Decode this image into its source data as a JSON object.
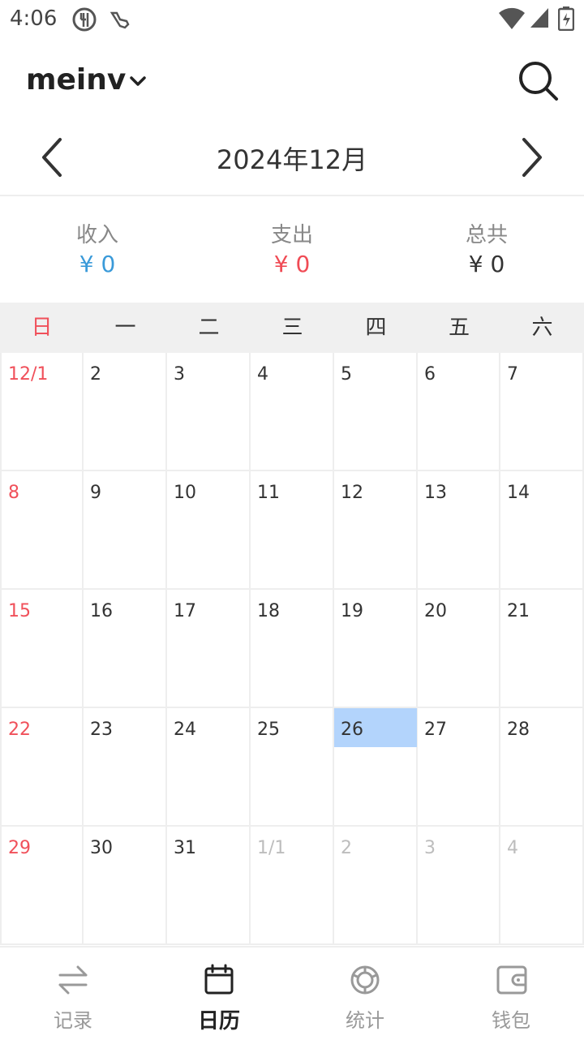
{
  "status_bar": {
    "time": "4:06"
  },
  "header": {
    "title": "meinv"
  },
  "month_nav": {
    "label": "2024年12月"
  },
  "summary": {
    "income": {
      "label": "收入",
      "value": "¥ 0",
      "color": "#3a9ad9"
    },
    "expense": {
      "label": "支出",
      "value": "¥ 0",
      "color": "#f04b55"
    },
    "total": {
      "label": "总共",
      "value": "¥ 0",
      "color": "#333333"
    }
  },
  "weekdays": [
    "日",
    "一",
    "二",
    "三",
    "四",
    "五",
    "六"
  ],
  "calendar": {
    "weeks": [
      [
        {
          "d": "12/1",
          "t": "sun"
        },
        {
          "d": "2"
        },
        {
          "d": "3"
        },
        {
          "d": "4"
        },
        {
          "d": "5"
        },
        {
          "d": "6"
        },
        {
          "d": "7"
        }
      ],
      [
        {
          "d": "8",
          "t": "sun"
        },
        {
          "d": "9"
        },
        {
          "d": "10"
        },
        {
          "d": "11"
        },
        {
          "d": "12"
        },
        {
          "d": "13"
        },
        {
          "d": "14"
        }
      ],
      [
        {
          "d": "15",
          "t": "sun"
        },
        {
          "d": "16"
        },
        {
          "d": "17"
        },
        {
          "d": "18"
        },
        {
          "d": "19"
        },
        {
          "d": "20"
        },
        {
          "d": "21"
        }
      ],
      [
        {
          "d": "22",
          "t": "sun"
        },
        {
          "d": "23"
        },
        {
          "d": "24"
        },
        {
          "d": "25"
        },
        {
          "d": "26",
          "today": true
        },
        {
          "d": "27"
        },
        {
          "d": "28"
        }
      ],
      [
        {
          "d": "29",
          "t": "sun"
        },
        {
          "d": "30"
        },
        {
          "d": "31"
        },
        {
          "d": "1/1",
          "t": "other"
        },
        {
          "d": "2",
          "t": "other"
        },
        {
          "d": "3",
          "t": "other"
        },
        {
          "d": "4",
          "t": "other"
        }
      ]
    ],
    "today_color": "#b3d4fc",
    "sunday_color": "#f0505a"
  },
  "bottom_nav": {
    "tabs": [
      {
        "label": "记录",
        "icon": "transfer-arrows-icon"
      },
      {
        "label": "日历",
        "icon": "calendar-icon",
        "active": true
      },
      {
        "label": "统计",
        "icon": "chart-ring-icon"
      },
      {
        "label": "钱包",
        "icon": "wallet-icon"
      }
    ]
  }
}
